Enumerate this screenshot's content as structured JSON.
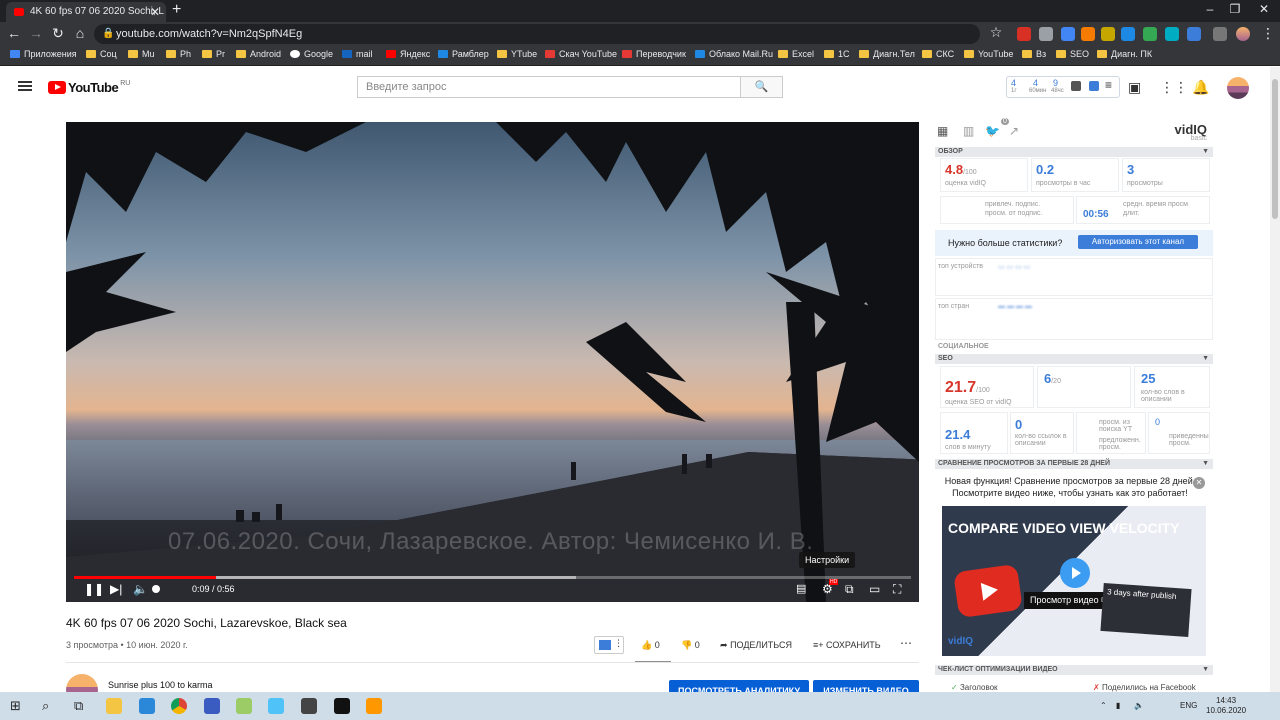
{
  "browser": {
    "tab_title": "4K 60 fps 07 06 2020 Sochi, L",
    "url": "youtube.com/watch?v=Nm2qSpfN4Eg",
    "bookmarks": [
      "Приложения",
      "Соц",
      "Mu",
      "Ph",
      "Pr",
      "Android",
      "Google",
      "mail",
      "Яндекс",
      "Рамблер",
      "YTube",
      "Скач YouTube",
      "Переводчик",
      "Облако Mail.Ru",
      "Excel",
      "1С",
      "Диагн.Тел",
      "СКС",
      "YouTube",
      "Вз",
      "SEO",
      "Диагн. ПК"
    ]
  },
  "youtube": {
    "logo_text": "YouTube",
    "region": "RU",
    "search_placeholder": "Введите запрос",
    "mini_stats": {
      "a": "4",
      "a_lbl": "1г",
      "b": "4",
      "b_lbl": "60мин",
      "c": "9",
      "c_lbl": "48чс"
    }
  },
  "video": {
    "watermark": "07.06.2020. Сочи, Лазаревское. Автор: Чемисенко И. В.",
    "tooltip": "Настройки",
    "time": "0:09 / 0:56",
    "progress": 0.17,
    "buffered": 0.6,
    "quality_badge": "HD"
  },
  "info": {
    "title": "4K 60 fps 07 06 2020 Sochi, Lazarevskoe, Black sea",
    "meta": "3 просмотра • 10 июн. 2020 г.",
    "likes": "0",
    "dislikes": "0",
    "share": "ПОДЕЛИТЬСЯ",
    "save": "СОХРАНИТЬ",
    "channel": "Sunrise plus 100 to karma",
    "analytics_btn": "ПОСМОТРЕТЬ АНАЛИТИКУ",
    "edit_btn": "ИЗМЕНИТЬ ВИДЕО"
  },
  "vidiq": {
    "logo": "vidIQ",
    "logo_sub": "basic",
    "badge": "0",
    "overview": "ОБЗОР",
    "score": "4.8",
    "score_max": "/100",
    "score_lbl": "оценка vidIQ",
    "vph": "0.2",
    "vph_lbl": "просмотры в час",
    "views": "3",
    "views_lbl": "просмотры",
    "subs_lbl": "привлеч. подпис.\nпросм. от подпис.",
    "avg_time": "00:56",
    "avg_lbl": "средн. время просм\nдлит.",
    "more_stats": "Нужно больше статистики?",
    "auth_btn": "Авторизовать этот канал",
    "top_devices": "топ устройств",
    "top_countries": "топ стран",
    "social": "СОЦИАЛЬНОЕ",
    "seo": "SEO",
    "seo_score": "21.7",
    "seo_max": "/100",
    "seo_lbl": "оценка SEO от vidIQ",
    "tags": "6",
    "tags_max": "/20",
    "desc_words": "25",
    "desc_words_lbl": "кол-во слов в описании",
    "wpm": "21.4",
    "wpm_lbl": "слов в минуту",
    "links": "0",
    "links_lbl": "кол-во ссылок в описании",
    "yt_search_lbl": "просм. из поиска YT",
    "sugg_lbl": "предложенн. просм.",
    "promoted": "0",
    "promoted_lbl": "приведенны просм.",
    "compare_hdr": "СРАВНЕНИЕ ПРОСМОТРОВ ЗА ПЕРВЫЕ 28 ДНЕЙ",
    "compare_text": "Новая функция! Сравнение просмотров за первые 28 дней. Посмотрите видео ниже, чтобы узнать как это работает!",
    "promo_title": "COMPARE VIDEO VIEW VELOCITY",
    "promo_watch": "Просмотр видео",
    "promo_card": "3 days after publish",
    "checklist_hdr": "ЧЕК-ЛИСТ ОПТИМИЗАЦИИ ВИДЕО",
    "check1": "Заголовок",
    "check2": "Поделились на Facebook"
  },
  "taskbar": {
    "lang": "ENG",
    "time": "14:43",
    "date": "10.06.2020"
  }
}
